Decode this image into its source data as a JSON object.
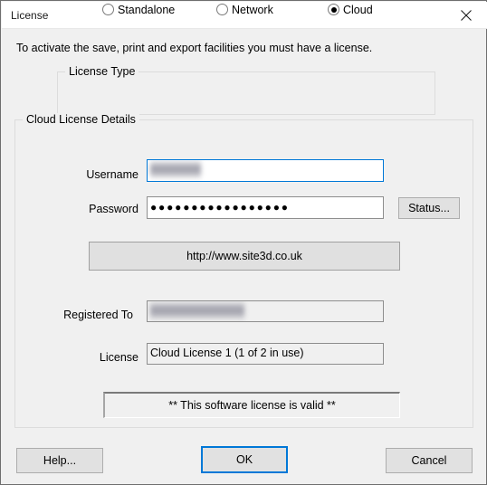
{
  "window": {
    "title": "License",
    "close_icon": "close-icon"
  },
  "intro_text": "To activate the save, print and export facilities you must have a license.",
  "license_type": {
    "group_title": "License Type",
    "options": [
      {
        "label": "Standalone",
        "selected": false
      },
      {
        "label": "Network",
        "selected": false
      },
      {
        "label": "Cloud",
        "selected": true
      }
    ]
  },
  "cloud_details": {
    "group_title": "Cloud License Details",
    "username": {
      "label": "Username",
      "value": "",
      "redacted": true,
      "redacted_width": 56,
      "focused": true
    },
    "password": {
      "label": "Password",
      "value": "●●●●●●●●●●●●●●●●●"
    },
    "status_button_label": "Status...",
    "url_banner": "http://www.site3d.co.uk",
    "registered_to": {
      "label": "Registered To",
      "value": "",
      "redacted": true,
      "redacted_width": 104,
      "readonly": true
    },
    "license": {
      "label": "License",
      "value": "Cloud License 1 (1 of 2 in use)",
      "readonly": true
    },
    "validity_message": "** This software license is valid **"
  },
  "footer": {
    "help_label": "Help...",
    "ok_label": "OK",
    "cancel_label": "Cancel"
  },
  "colors": {
    "dialog_background": "#f0f0f0",
    "titlebar_background": "#ffffff",
    "accent": "#0078d7",
    "border": "#6e6e6e",
    "group_border": "#dcdcdc",
    "field_border": "#8e8e8e",
    "button_face": "#e1e1e1"
  }
}
